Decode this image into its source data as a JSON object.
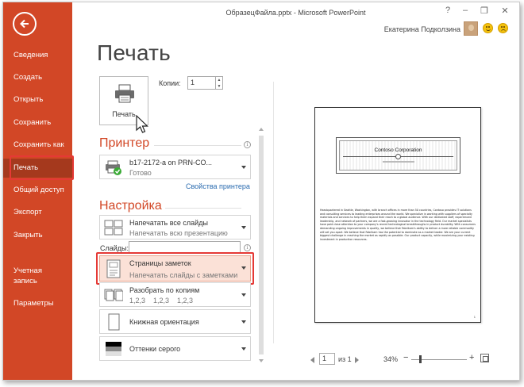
{
  "window": {
    "title": "ОбразецФайла.pptx - Microsoft PowerPoint",
    "help": "?",
    "minimize": "–",
    "restore": "❐",
    "close": "✕"
  },
  "user": {
    "name": "Екатерина Подколзина"
  },
  "sidebar": {
    "items": [
      {
        "label": "Сведения"
      },
      {
        "label": "Создать"
      },
      {
        "label": "Открыть"
      },
      {
        "label": "Сохранить"
      },
      {
        "label": "Сохранить как"
      },
      {
        "label": "Печать",
        "active": true
      },
      {
        "label": "Общий доступ"
      },
      {
        "label": "Экспорт"
      },
      {
        "label": "Закрыть"
      },
      {
        "label": "Учетная запись"
      },
      {
        "label": "Параметры"
      }
    ]
  },
  "print": {
    "heading": "Печать",
    "button_label": "Печать",
    "copies_label": "Копии:",
    "copies_value": "1"
  },
  "printer": {
    "section_title": "Принтер",
    "name": "b17-2172-a on PRN-CO...",
    "status": "Готово",
    "properties_link": "Свойства принтера"
  },
  "settings": {
    "section_title": "Настройка",
    "range": {
      "title": "Напечатать все слайды",
      "subtitle": "Напечатать всю презентацию"
    },
    "slides_label": "Слайды:",
    "slides_value": "",
    "layout": {
      "title": "Страницы заметок",
      "subtitle": "Напечатать слайды с заметками"
    },
    "collate": {
      "title": "Разобрать по копиям",
      "subtitle": "1,2,3    1,2,3    1,2,3"
    },
    "orientation": {
      "title": "Книжная ориентация"
    },
    "color": {
      "title": "Оттенки серого"
    }
  },
  "preview": {
    "company": "Contoso Corporation",
    "notes": "Headquartered in Seattle, Washington, with branch offices in more than 50 countries, Contoso provides IT solutions and consulting services to leading enterprises around the world. We specialize in working with suppliers of specialty materials and services to help them expand their reach to a global audience. With our dedicated staff, experienced leadership, and network of partners, we are a fast-growing innovator in the technology field. Our market specialists have paid close attention to your company's recent technological breakthroughs in product durability. With consumers demanding ongoing improvements in quality, we believe that Fabrikam's ability to deliver a more reliable commodity will set you apart. We believe that Fabrikam has the potential to dominate as a market leader. We are your current biggest challenge in reaching the market as rapidly as possible. Our product capacity, while maximizing your existing investment in production resources.",
    "page_number": "1",
    "current_page": "1",
    "of_pages": "из 1",
    "zoom": "34%"
  },
  "colors": {
    "accent": "#d24726",
    "accent_dark": "#a5391d",
    "highlight": "#e53935",
    "link": "#2b6cb0"
  }
}
